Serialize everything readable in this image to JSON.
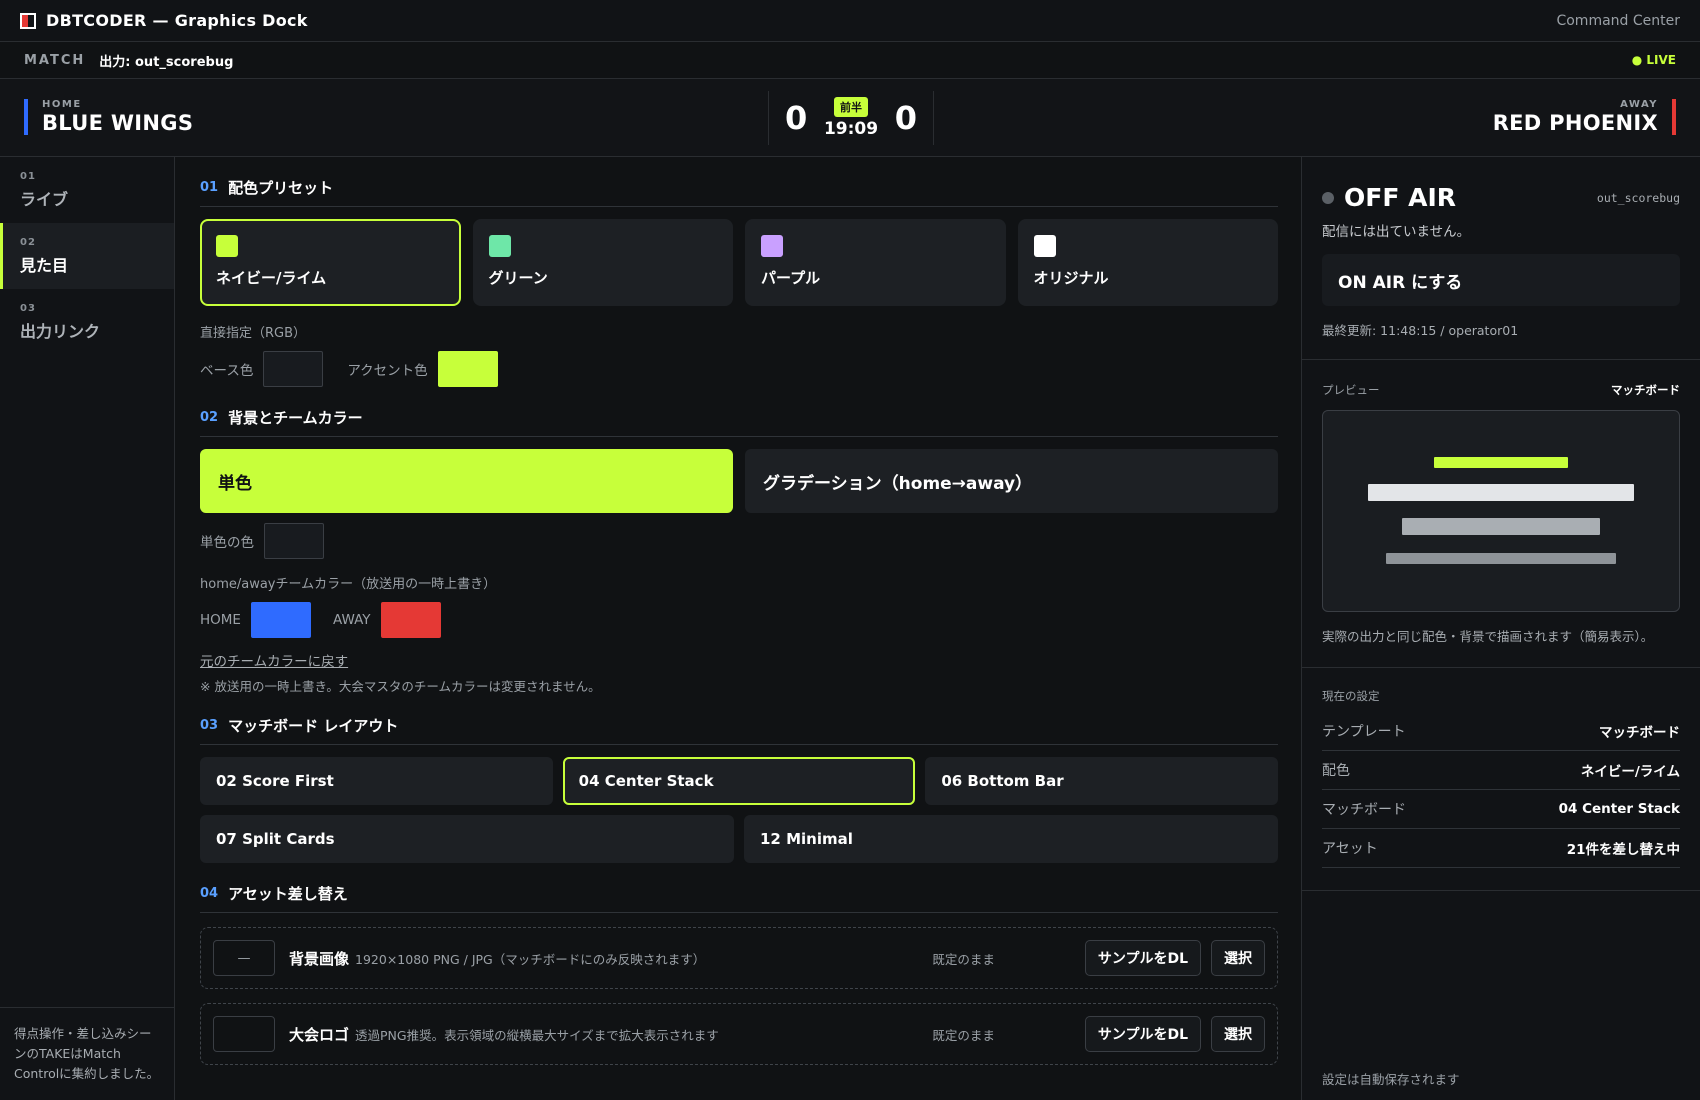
{
  "app": {
    "title": "DBTCODER — Graphics Dock",
    "top_right": "Command Center"
  },
  "matchbar": {
    "label": "MATCH",
    "output": "出力: out_scorebug",
    "live": "● LIVE"
  },
  "scoreboard": {
    "home": {
      "side": "HOME",
      "name": "BLUE WINGS",
      "score": "0",
      "color": "#2f6bff"
    },
    "away": {
      "side": "AWAY",
      "name": "RED PHOENIX",
      "score": "0",
      "color": "#e53935"
    },
    "half": "前半",
    "clock": "19:09"
  },
  "sidebar": {
    "items": [
      {
        "num": "01",
        "label": "ライブ"
      },
      {
        "num": "02",
        "label": "見た目"
      },
      {
        "num": "03",
        "label": "出力リンク"
      }
    ],
    "active_index": 1,
    "note": "得点操作・差し込みシーンのTAKEはMatch Controlに集約しました。"
  },
  "sections": {
    "s1": {
      "num": "01",
      "title": "配色プリセット"
    },
    "s2": {
      "num": "02",
      "title": "背景とチームカラー"
    },
    "s3": {
      "num": "03",
      "title": "マッチボード レイアウト"
    },
    "s4": {
      "num": "04",
      "title": "アセット差し替え"
    }
  },
  "presets": [
    {
      "label": "ネイビー/ライム",
      "color": "#c7ff3a",
      "selected": true
    },
    {
      "label": "グリーン",
      "color": "#6ee7a8",
      "selected": false
    },
    {
      "label": "パープル",
      "color": "#c9a0ff",
      "selected": false
    },
    {
      "label": "オリジナル",
      "color": "#ffffff",
      "selected": false
    }
  ],
  "direct": {
    "title": "直接指定（RGB）",
    "base_label": "ベース色",
    "base_color": "#181b1f",
    "accent_label": "アクセント色",
    "accent_color": "#c7ff3a"
  },
  "background": {
    "modes": [
      "単色",
      "グラデーション（home→away）"
    ],
    "selected": 0,
    "solid_label": "単色の色",
    "solid_color": "#181b1f",
    "team_title": "home/awayチームカラー（放送用の一時上書き）",
    "home_label": "HOME",
    "home_color": "#2f6bff",
    "away_label": "AWAY",
    "away_color": "#e53935",
    "reset_link": "元のチームカラーに戻す",
    "note": "※ 放送用の一時上書き。大会マスタのチームカラーは変更されません。"
  },
  "layouts": {
    "row1": [
      "02 Score First",
      "04 Center Stack",
      "06 Bottom Bar"
    ],
    "row2": [
      "07 Split Cards",
      "12 Minimal"
    ],
    "selected": "04 Center Stack"
  },
  "assets": [
    {
      "thumb": "—",
      "name": "背景画像",
      "desc": "1920×1080 PNG / JPG（マッチボードにのみ反映されます）",
      "state": "既定のまま",
      "dl": "サンプルをDL",
      "select": "選択"
    },
    {
      "thumb": "",
      "name": "大会ロゴ",
      "desc": "透過PNG推奨。表示領域の縦横最大サイズまで拡大表示されます",
      "state": "既定のまま",
      "dl": "サンプルをDL",
      "select": "選択"
    }
  ],
  "right": {
    "status": "OFF AIR",
    "output": "out_scorebug",
    "status_sub": "配信には出ていません。",
    "onair_button": "ON AIR にする",
    "last_update": "最終更新: 11:48:15 / operator01",
    "preview_label": "プレビュー",
    "preview_mode": "マッチボード",
    "preview_caption": "実際の出力と同じ配色・背景で描画されます（簡易表示）。",
    "current_title": "現在の設定",
    "current": [
      {
        "key": "テンプレート",
        "value": "マッチボード"
      },
      {
        "key": "配色",
        "value": "ネイビー/ライム"
      },
      {
        "key": "マッチボード",
        "value": "04 Center Stack"
      },
      {
        "key": "アセット",
        "value": "21件を差し替え中"
      }
    ],
    "autosave": "設定は自動保存されます"
  }
}
